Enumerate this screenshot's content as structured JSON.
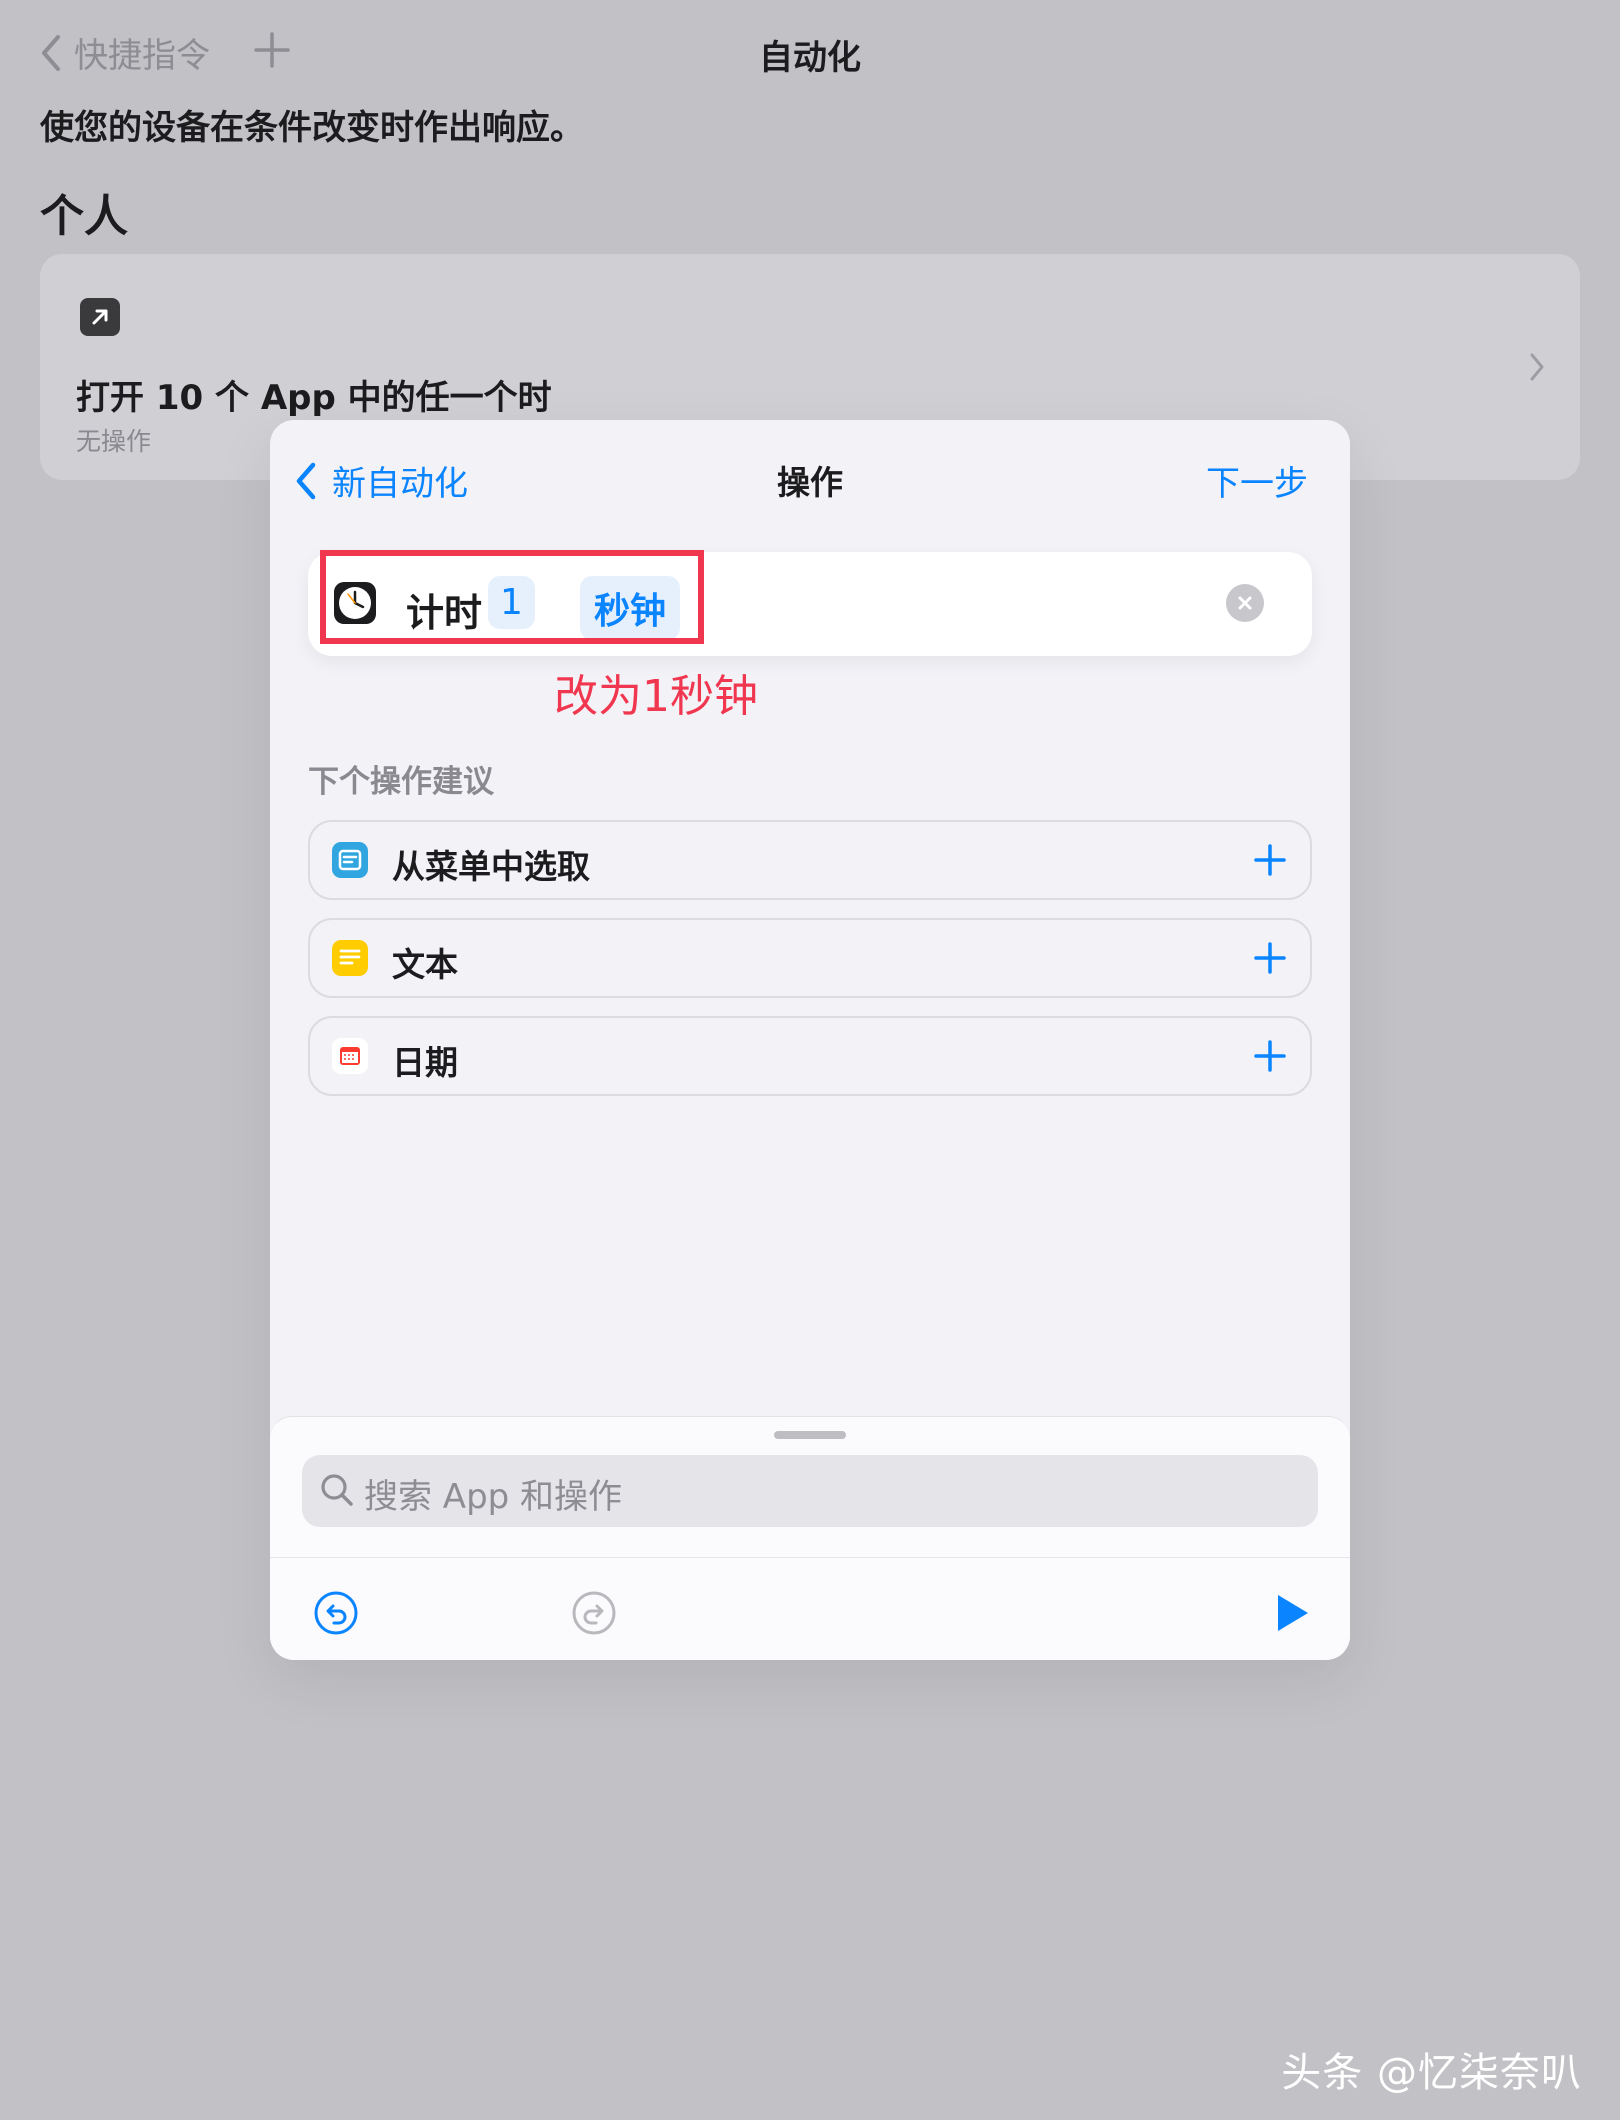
{
  "background": {
    "back_label": "快捷指令",
    "title": "自动化",
    "description": "使您的设备在条件改变时作出响应。",
    "section_title": "个人",
    "card": {
      "title": "打开 10 个 App 中的任一个时",
      "subtitle": "无操作"
    }
  },
  "modal": {
    "back_label": "新自动化",
    "title": "操作",
    "next_label": "下一步",
    "action": {
      "label": "计时",
      "number": "1",
      "unit": "秒钟"
    },
    "annotation": "改为1秒钟",
    "suggestions_title": "下个操作建议",
    "suggestions": [
      {
        "label": "从菜单中选取",
        "icon": "menu-choose-icon",
        "color": "#30a5e0"
      },
      {
        "label": "文本",
        "icon": "text-icon",
        "color": "#ffcc00"
      },
      {
        "label": "日期",
        "icon": "calendar-icon",
        "color": "#ff3b30"
      }
    ],
    "search_placeholder": "搜索 App 和操作"
  },
  "watermark": "头条 @忆柒奈叭",
  "colors": {
    "accent": "#0a84ff",
    "annotation_red": "#f1364f"
  }
}
